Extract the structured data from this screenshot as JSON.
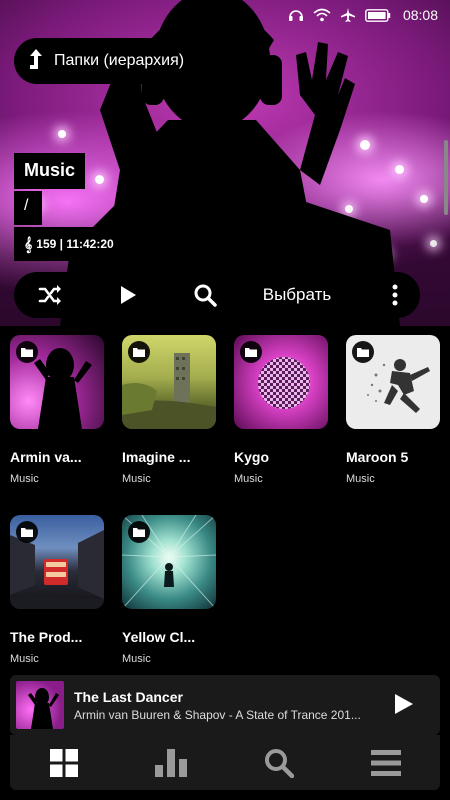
{
  "status_bar": {
    "time": "08:08",
    "icons": [
      "headphones-icon",
      "wifi-icon",
      "airplane-icon",
      "battery-icon"
    ]
  },
  "header": {
    "folders_button_label": "Папки (иерархия)",
    "folder_title": "Music",
    "folder_path": "/",
    "track_count": "159",
    "total_duration": "11:42:20",
    "stats_text": "159 | 11:42:20"
  },
  "controls": {
    "shuffle_icon": "shuffle-icon",
    "play_icon": "play-icon",
    "search_icon": "search-icon",
    "select_label": "Выбрать",
    "more_icon": "more-vert-icon"
  },
  "folders": [
    {
      "name": "Armin va...",
      "subtitle": "Music"
    },
    {
      "name": "Imagine ...",
      "subtitle": "Music"
    },
    {
      "name": "Kygo",
      "subtitle": "Music"
    },
    {
      "name": "Maroon 5",
      "subtitle": "Music"
    },
    {
      "name": "The Prod...",
      "subtitle": "Music"
    },
    {
      "name": "Yellow Cl...",
      "subtitle": "Music"
    }
  ],
  "now_playing": {
    "title": "The Last Dancer",
    "artist_line": "Armin van Buuren & Shapov - A State of Trance 201..."
  },
  "bottom_nav": {
    "items": [
      "grid-icon",
      "equalizer-icon",
      "search-icon",
      "menu-icon"
    ]
  },
  "colors": {
    "accent_magenta": "#c23bb6",
    "surface": "#1a1a1a",
    "background": "#000000"
  }
}
